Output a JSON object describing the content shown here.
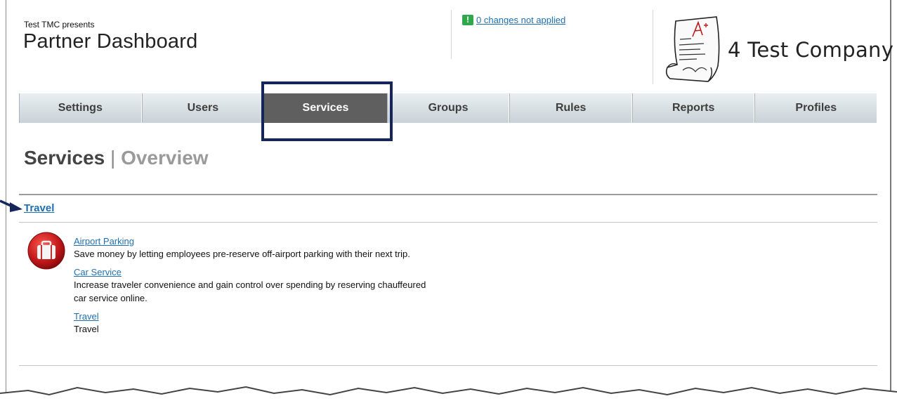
{
  "header": {
    "presents": "Test TMC presents",
    "title": "Partner Dashboard",
    "changes_link": "0 changes not applied",
    "company": "4 Test Company"
  },
  "nav": {
    "tabs": [
      {
        "label": "Settings"
      },
      {
        "label": "Users"
      },
      {
        "label": "Services"
      },
      {
        "label": "Groups"
      },
      {
        "label": "Rules"
      },
      {
        "label": "Reports"
      },
      {
        "label": "Profiles"
      }
    ],
    "active": "Services"
  },
  "page": {
    "title_main": "Services",
    "title_sep": " | ",
    "title_sub": "Overview"
  },
  "category": {
    "label": "Travel",
    "icon": "suitcase-icon",
    "services": [
      {
        "name": "Airport Parking",
        "description": "Save money by letting employees pre-reserve off-airport parking with their next trip."
      },
      {
        "name": "Car Service",
        "description": "Increase traveler convenience and gain control over spending by reserving chauffeured car service online."
      },
      {
        "name": "Travel",
        "description": "Travel"
      }
    ]
  },
  "colors": {
    "link": "#1f6fb0",
    "active_tab": "#5f5f5f",
    "highlight": "#14265a",
    "alert_green": "#2ea84a",
    "icon_red": "#c0171a"
  }
}
